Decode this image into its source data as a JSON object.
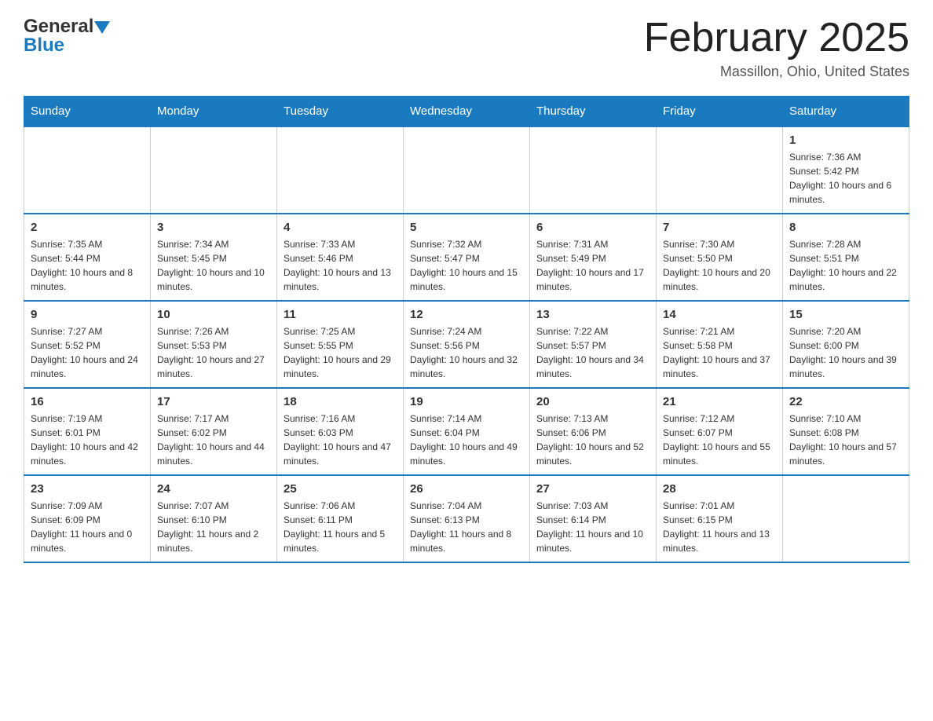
{
  "header": {
    "logo_general": "General",
    "logo_blue": "Blue",
    "month_title": "February 2025",
    "location": "Massillon, Ohio, United States"
  },
  "weekdays": [
    "Sunday",
    "Monday",
    "Tuesday",
    "Wednesday",
    "Thursday",
    "Friday",
    "Saturday"
  ],
  "rows": [
    [
      {
        "day": "",
        "info": ""
      },
      {
        "day": "",
        "info": ""
      },
      {
        "day": "",
        "info": ""
      },
      {
        "day": "",
        "info": ""
      },
      {
        "day": "",
        "info": ""
      },
      {
        "day": "",
        "info": ""
      },
      {
        "day": "1",
        "info": "Sunrise: 7:36 AM\nSunset: 5:42 PM\nDaylight: 10 hours and 6 minutes."
      }
    ],
    [
      {
        "day": "2",
        "info": "Sunrise: 7:35 AM\nSunset: 5:44 PM\nDaylight: 10 hours and 8 minutes."
      },
      {
        "day": "3",
        "info": "Sunrise: 7:34 AM\nSunset: 5:45 PM\nDaylight: 10 hours and 10 minutes."
      },
      {
        "day": "4",
        "info": "Sunrise: 7:33 AM\nSunset: 5:46 PM\nDaylight: 10 hours and 13 minutes."
      },
      {
        "day": "5",
        "info": "Sunrise: 7:32 AM\nSunset: 5:47 PM\nDaylight: 10 hours and 15 minutes."
      },
      {
        "day": "6",
        "info": "Sunrise: 7:31 AM\nSunset: 5:49 PM\nDaylight: 10 hours and 17 minutes."
      },
      {
        "day": "7",
        "info": "Sunrise: 7:30 AM\nSunset: 5:50 PM\nDaylight: 10 hours and 20 minutes."
      },
      {
        "day": "8",
        "info": "Sunrise: 7:28 AM\nSunset: 5:51 PM\nDaylight: 10 hours and 22 minutes."
      }
    ],
    [
      {
        "day": "9",
        "info": "Sunrise: 7:27 AM\nSunset: 5:52 PM\nDaylight: 10 hours and 24 minutes."
      },
      {
        "day": "10",
        "info": "Sunrise: 7:26 AM\nSunset: 5:53 PM\nDaylight: 10 hours and 27 minutes."
      },
      {
        "day": "11",
        "info": "Sunrise: 7:25 AM\nSunset: 5:55 PM\nDaylight: 10 hours and 29 minutes."
      },
      {
        "day": "12",
        "info": "Sunrise: 7:24 AM\nSunset: 5:56 PM\nDaylight: 10 hours and 32 minutes."
      },
      {
        "day": "13",
        "info": "Sunrise: 7:22 AM\nSunset: 5:57 PM\nDaylight: 10 hours and 34 minutes."
      },
      {
        "day": "14",
        "info": "Sunrise: 7:21 AM\nSunset: 5:58 PM\nDaylight: 10 hours and 37 minutes."
      },
      {
        "day": "15",
        "info": "Sunrise: 7:20 AM\nSunset: 6:00 PM\nDaylight: 10 hours and 39 minutes."
      }
    ],
    [
      {
        "day": "16",
        "info": "Sunrise: 7:19 AM\nSunset: 6:01 PM\nDaylight: 10 hours and 42 minutes."
      },
      {
        "day": "17",
        "info": "Sunrise: 7:17 AM\nSunset: 6:02 PM\nDaylight: 10 hours and 44 minutes."
      },
      {
        "day": "18",
        "info": "Sunrise: 7:16 AM\nSunset: 6:03 PM\nDaylight: 10 hours and 47 minutes."
      },
      {
        "day": "19",
        "info": "Sunrise: 7:14 AM\nSunset: 6:04 PM\nDaylight: 10 hours and 49 minutes."
      },
      {
        "day": "20",
        "info": "Sunrise: 7:13 AM\nSunset: 6:06 PM\nDaylight: 10 hours and 52 minutes."
      },
      {
        "day": "21",
        "info": "Sunrise: 7:12 AM\nSunset: 6:07 PM\nDaylight: 10 hours and 55 minutes."
      },
      {
        "day": "22",
        "info": "Sunrise: 7:10 AM\nSunset: 6:08 PM\nDaylight: 10 hours and 57 minutes."
      }
    ],
    [
      {
        "day": "23",
        "info": "Sunrise: 7:09 AM\nSunset: 6:09 PM\nDaylight: 11 hours and 0 minutes."
      },
      {
        "day": "24",
        "info": "Sunrise: 7:07 AM\nSunset: 6:10 PM\nDaylight: 11 hours and 2 minutes."
      },
      {
        "day": "25",
        "info": "Sunrise: 7:06 AM\nSunset: 6:11 PM\nDaylight: 11 hours and 5 minutes."
      },
      {
        "day": "26",
        "info": "Sunrise: 7:04 AM\nSunset: 6:13 PM\nDaylight: 11 hours and 8 minutes."
      },
      {
        "day": "27",
        "info": "Sunrise: 7:03 AM\nSunset: 6:14 PM\nDaylight: 11 hours and 10 minutes."
      },
      {
        "day": "28",
        "info": "Sunrise: 7:01 AM\nSunset: 6:15 PM\nDaylight: 11 hours and 13 minutes."
      },
      {
        "day": "",
        "info": ""
      }
    ]
  ]
}
